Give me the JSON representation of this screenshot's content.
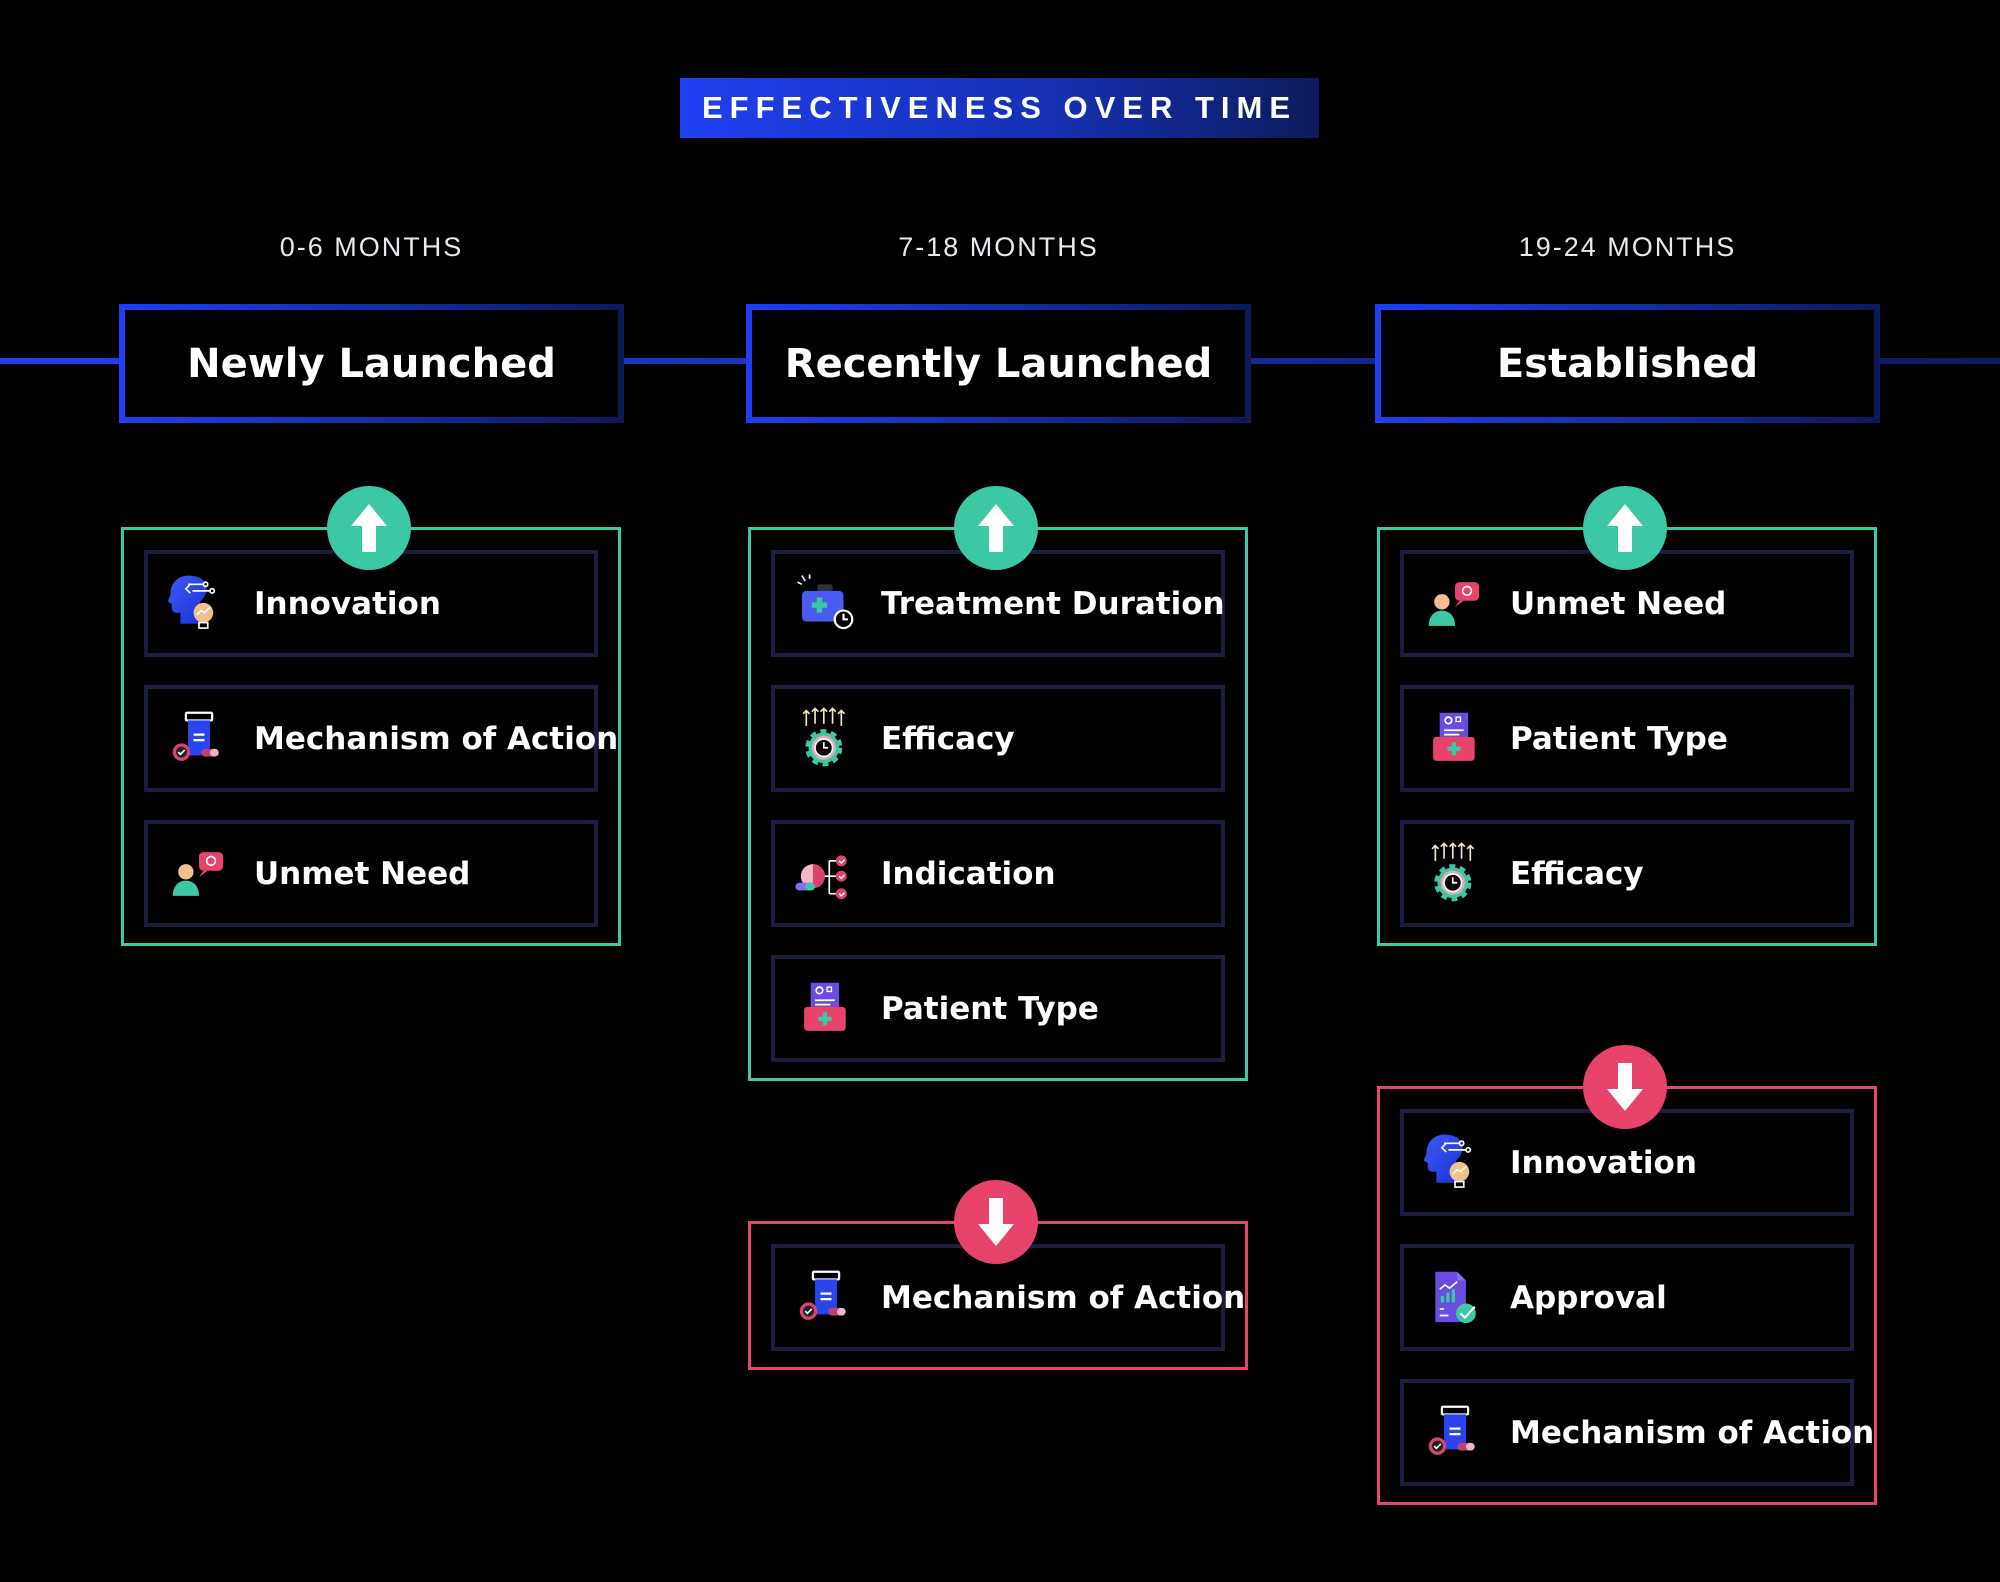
{
  "title": "EFFECTIVENESS OVER TIME",
  "colors": {
    "accent_blue": "#1f3ff0",
    "increase": "#3cc7a5",
    "decrease": "#e8436a",
    "item_border": "#1b1e3e"
  },
  "columns": [
    {
      "period": "0-6 MONTHS",
      "stage": "Newly Launched",
      "increasing": [
        {
          "label": "Innovation",
          "icon": "innovation-icon"
        },
        {
          "label": "Mechanism of Action",
          "icon": "mechanism-icon"
        },
        {
          "label": "Unmet Need",
          "icon": "unmet-need-icon"
        }
      ],
      "decreasing": []
    },
    {
      "period": "7-18 MONTHS",
      "stage": "Recently Launched",
      "increasing": [
        {
          "label": "Treatment Duration",
          "icon": "treatment-duration-icon"
        },
        {
          "label": "Efficacy",
          "icon": "efficacy-icon"
        },
        {
          "label": "Indication",
          "icon": "indication-icon"
        },
        {
          "label": "Patient Type",
          "icon": "patient-type-icon"
        }
      ],
      "decreasing": [
        {
          "label": "Mechanism of Action",
          "icon": "mechanism-icon"
        }
      ]
    },
    {
      "period": "19-24 MONTHS",
      "stage": "Established",
      "increasing": [
        {
          "label": "Unmet Need",
          "icon": "unmet-need-icon"
        },
        {
          "label": "Patient Type",
          "icon": "patient-type-icon"
        },
        {
          "label": "Efficacy",
          "icon": "efficacy-icon"
        }
      ],
      "decreasing": [
        {
          "label": "Innovation",
          "icon": "innovation-icon"
        },
        {
          "label": "Approval",
          "icon": "approval-icon"
        },
        {
          "label": "Mechanism of Action",
          "icon": "mechanism-icon"
        }
      ]
    }
  ]
}
